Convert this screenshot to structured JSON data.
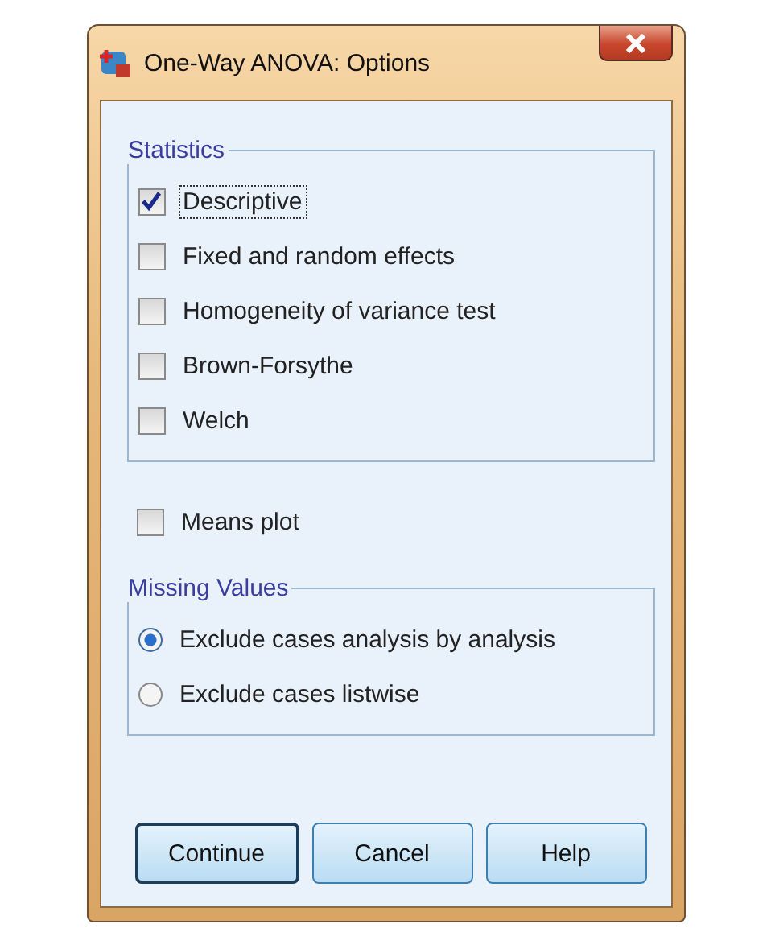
{
  "window": {
    "title": "One-Way ANOVA: Options"
  },
  "statistics": {
    "title": "Statistics",
    "options": [
      {
        "label": "Descriptive",
        "checked": true,
        "focused": true
      },
      {
        "label": "Fixed and random effects",
        "checked": false,
        "focused": false
      },
      {
        "label": "Homogeneity of variance test",
        "checked": false,
        "focused": false
      },
      {
        "label": "Brown-Forsythe",
        "checked": false,
        "focused": false
      },
      {
        "label": "Welch",
        "checked": false,
        "focused": false
      }
    ]
  },
  "means_plot": {
    "label": "Means plot",
    "checked": false
  },
  "missing_values": {
    "title": "Missing Values",
    "options": [
      {
        "label": "Exclude cases analysis by analysis",
        "selected": true
      },
      {
        "label": "Exclude cases listwise",
        "selected": false
      }
    ]
  },
  "buttons": [
    {
      "label": "Continue",
      "default": true
    },
    {
      "label": "Cancel",
      "default": false
    },
    {
      "label": "Help",
      "default": false
    }
  ]
}
